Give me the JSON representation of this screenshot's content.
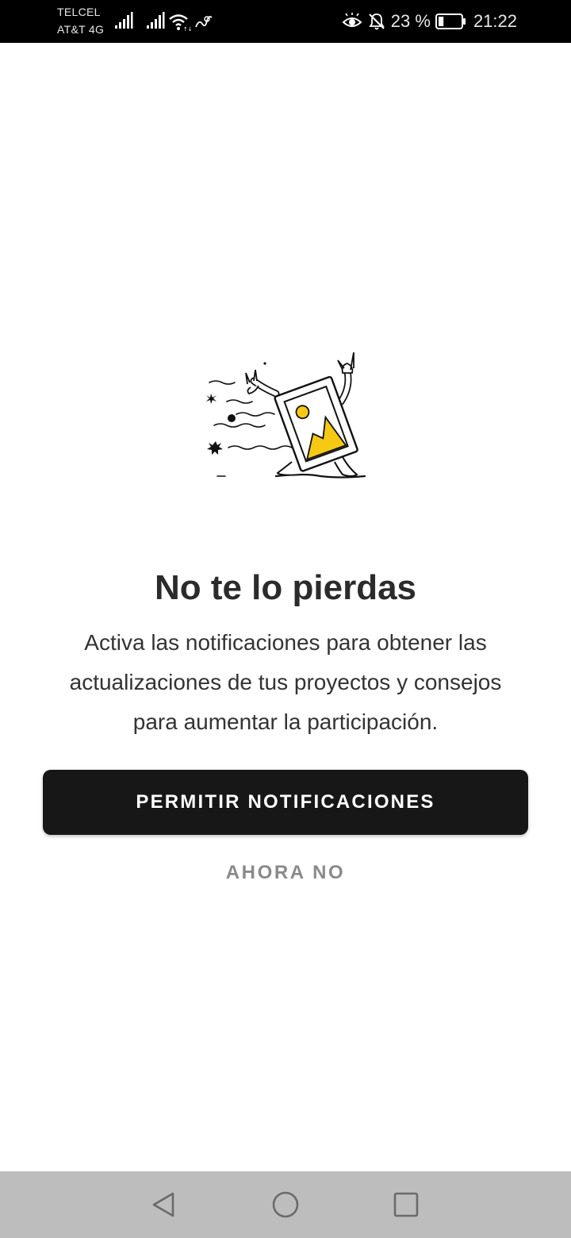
{
  "status_bar": {
    "carrier_1": "TELCEL",
    "carrier_2": "AT&T 4G",
    "battery_percent": "23 %",
    "battery_level": 0.23,
    "time": "21:22",
    "icons": [
      "signal-icon",
      "signal-icon",
      "wifi-icon",
      "data-saver-icon",
      "eye-comfort-icon",
      "notifications-off-icon",
      "battery-icon"
    ]
  },
  "dialog": {
    "title": "No te lo pierdas",
    "body": "Activa las notificaciones para obtener las actualizaciones de tus proyectos y consejos para aumentar la participación.",
    "primary_button": "PERMITIR NOTIFICACIONES",
    "secondary_button": "AHORA NO"
  },
  "nav_bar": {
    "buttons": [
      "back-icon",
      "home-icon",
      "recents-icon"
    ]
  },
  "colors": {
    "accent_yellow": "#f6c915",
    "button_dark": "#171717",
    "secondary_text": "#8a8a8a",
    "nav_bar": "#bdbdbd"
  }
}
